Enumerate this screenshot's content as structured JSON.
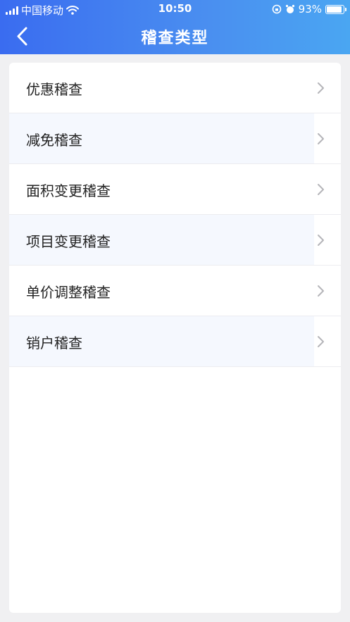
{
  "status_bar": {
    "carrier": "中国移动",
    "time": "10:50",
    "battery": "93%",
    "battery_level": 0.93
  },
  "nav": {
    "title": "稽查类型",
    "back_icon": "chevron-left-icon"
  },
  "items": [
    {
      "label": "优惠稽查",
      "icon": "chevron-right-icon"
    },
    {
      "label": "减免稽查",
      "icon": "chevron-right-icon"
    },
    {
      "label": "面积变更稽查",
      "icon": "chevron-right-icon"
    },
    {
      "label": "项目变更稽查",
      "icon": "chevron-right-icon"
    },
    {
      "label": "单价调整稽查",
      "icon": "chevron-right-icon"
    },
    {
      "label": "销户稽查",
      "icon": "chevron-right-icon"
    }
  ],
  "colors": {
    "header_start": "#3a6cf0",
    "header_end": "#4aa6f2",
    "alt_row": "#f5f8fe",
    "chevron": "#b5b5b9"
  }
}
